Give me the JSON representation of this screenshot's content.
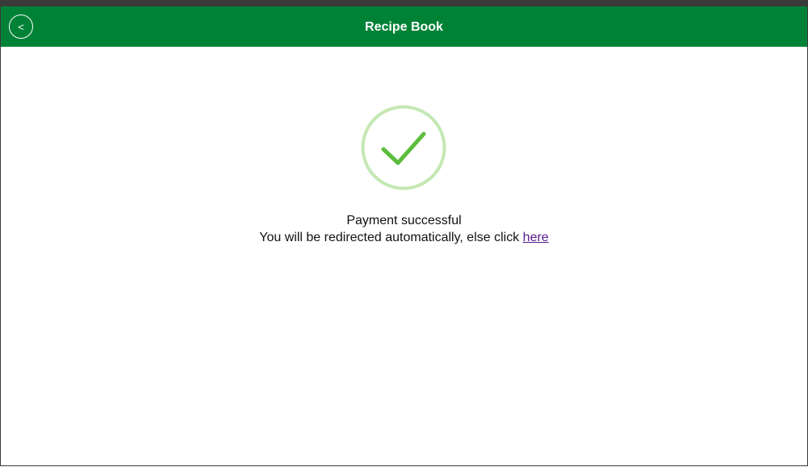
{
  "header": {
    "title": "Recipe Book",
    "back_label": "<",
    "back_icon": "chevron-left-icon",
    "background_color": "#008236"
  },
  "status": {
    "icon": "checkmark-circle-icon",
    "ring_color": "#c4e8b4",
    "check_color": "#5abd3c",
    "message": "Payment successful",
    "redirect_text": "You will be redirected automatically, else click",
    "link_text": "here"
  }
}
